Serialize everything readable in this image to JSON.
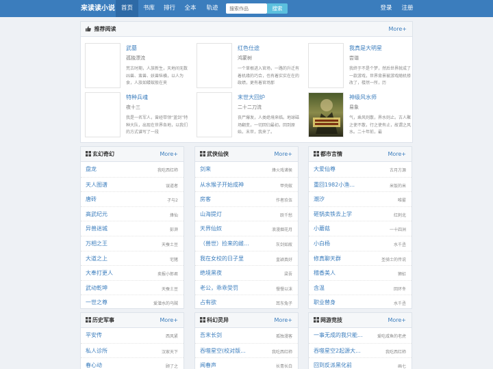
{
  "nav": {
    "brand": "来读读小说",
    "items": [
      "首页",
      "书库",
      "排行",
      "全本",
      "轨迹"
    ],
    "search_placeholder": "搜索作品",
    "search_button": "搜索",
    "login": "登录",
    "register": "注册"
  },
  "recommend": {
    "title": "推荐阅读",
    "more": "More+",
    "items": [
      {
        "title": "武墓",
        "author": "孤独漂流",
        "desc": "荒古时期，人族新生，天地间无数凶兽、蛮兽、妖兽纵横，以人为食，人族如蝼蚁般在夹"
      },
      {
        "title": "红色仕途",
        "author": "鸿蒙树",
        "desc": "一个草根进入官场，一路的升迁有着机缘的巧合，也有着实实在在的政绩，更有着官场那"
      },
      {
        "title": "我真是大明星",
        "author": "尝谐",
        "desc": "我终于不是个梦，然后世界就成了一款游戏，世界背景被游戏随机修改了，楼然一所，历"
      },
      {
        "title": "特种兵魂",
        "author": "夜十三",
        "desc": "我是一名军人，曾经带领“蓝剑”特种大队，出现在世界各地，以我们的方式谱写了一段"
      },
      {
        "title": "末世大回炉",
        "author": "二十二刀流",
        "desc": "丧尸爆发，人类绝境来临。地球磁场翻变，一切回归最初。回到原始，末世，我来了。"
      },
      {
        "title": "神级风水师",
        "author": "易象",
        "desc": "气，乘风则散，界水则止。古人聚之使不散，行之使有止，故谓之风水。二十年前，最"
      }
    ]
  },
  "categories": [
    {
      "title": "玄幻奇幻",
      "more": "More+",
      "books": [
        {
          "name": "盘龙",
          "author": "我吃西红柿"
        },
        {
          "name": "天人图谱",
          "author": "误道者"
        },
        {
          "name": "唐砖",
          "author": "孑与2"
        },
        {
          "name": "高武纪元",
          "author": "烽仙"
        },
        {
          "name": "异兽迷城",
          "author": "彭湃"
        },
        {
          "name": "万相之王",
          "author": "天蚕土豆"
        },
        {
          "name": "大道之上",
          "author": "宅猪"
        },
        {
          "name": "大奉打更人",
          "author": "卖报小郎君"
        },
        {
          "name": "武动乾坤",
          "author": "天蚕土豆"
        },
        {
          "name": "一世之尊",
          "author": "爱潜水的乌贼"
        }
      ]
    },
    {
      "title": "武侠仙侠",
      "more": "More+",
      "books": [
        {
          "name": "剑来",
          "author": "烽火戏诸侯"
        },
        {
          "name": "从水猴子开始成神",
          "author": "甲壳蚁"
        },
        {
          "name": "房客",
          "author": "作者玖伍"
        },
        {
          "name": "山海提灯",
          "author": "跃千愁"
        },
        {
          "name": "天界仙奴",
          "author": "浪漫烟花月"
        },
        {
          "name": "（兽世）捡来的雌...",
          "author": "灰剑如故"
        },
        {
          "name": "我在女校的日子里",
          "author": "皇颖真好"
        },
        {
          "name": "绝境黑夜",
          "author": "梁吾"
        },
        {
          "name": "老公，乖乖受罚",
          "author": "慢慢以沫"
        },
        {
          "name": "占有欲",
          "author": "耳东兔子"
        }
      ]
    },
    {
      "title": "都市言情",
      "more": "More+",
      "books": [
        {
          "name": "大爱仙尊",
          "author": "古月方源"
        },
        {
          "name": "重回1982小渔...",
          "author": "米饭的米"
        },
        {
          "name": "潮汐",
          "author": "唯雾"
        },
        {
          "name": "砸锅卖铁去上学",
          "author": "红刺北"
        },
        {
          "name": "小蘑菇",
          "author": "一十四洲"
        },
        {
          "name": "小白杨",
          "author": "水千丞"
        },
        {
          "name": "修真聊天群",
          "author": "圣骑士的传说"
        },
        {
          "name": "稽香美人",
          "author": "狮虹"
        },
        {
          "name": "含温",
          "author": "回环冬"
        },
        {
          "name": "职业替身",
          "author": "水千丞"
        }
      ]
    },
    {
      "title": "历史军事",
      "more": "More+",
      "books": [
        {
          "name": "平安传",
          "author": "西风紧"
        },
        {
          "name": "私人诊所",
          "author": "汉家天下"
        },
        {
          "name": "春心动",
          "author": "顾了之"
        }
      ]
    },
    {
      "title": "科幻灵异",
      "more": "More+",
      "books": [
        {
          "name": "吾末长剑",
          "author": "孤独漫客"
        },
        {
          "name": "吞噬星空(校对版...",
          "author": "我吃西红柿"
        },
        {
          "name": "闻春声",
          "author": "长青长白"
        }
      ]
    },
    {
      "title": "网游竞技",
      "more": "More+",
      "books": [
        {
          "name": "一事无成的我只能...",
          "author": "爱吃咸鱼的老虎"
        },
        {
          "name": "吞噬星空2起源大...",
          "author": "我吃西红柿"
        },
        {
          "name": "回到反派黑化前",
          "author": "画七"
        }
      ]
    }
  ]
}
